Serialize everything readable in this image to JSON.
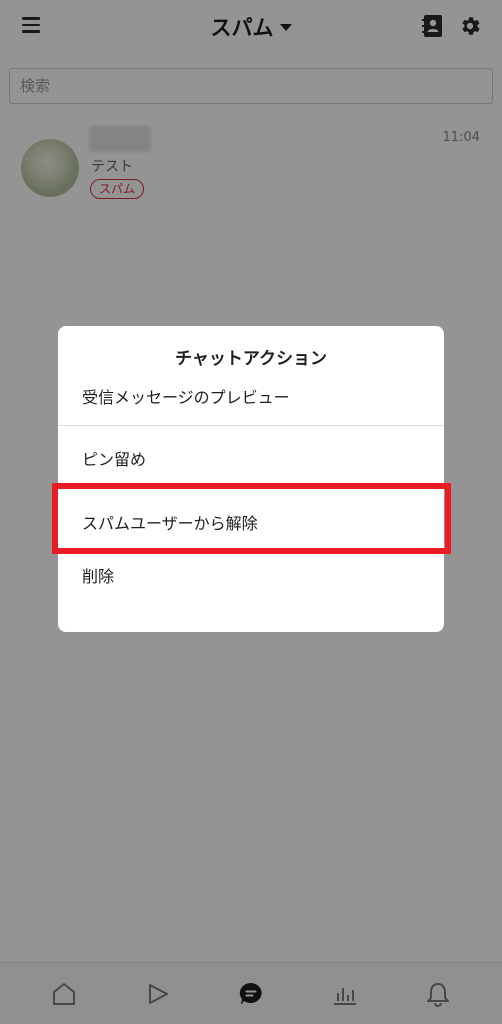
{
  "header": {
    "title": "スパム"
  },
  "search": {
    "placeholder": "検索"
  },
  "chat_list": [
    {
      "preview": "テスト",
      "badge": "スパム",
      "time": "11:04"
    }
  ],
  "dialog": {
    "title": "チャットアクション",
    "items": [
      "受信メッセージのプレビュー",
      "ピン留め",
      "スパムユーザーから解除",
      "削除"
    ]
  },
  "tabbar": {
    "tabs": [
      "home-icon",
      "play-icon",
      "chat-icon",
      "stats-icon",
      "bell-icon"
    ],
    "active_index": 2
  },
  "colors": {
    "badge": "#d3323c",
    "highlight": "#ec1c24",
    "overlay": "rgba(0,0,0,0.42)"
  }
}
